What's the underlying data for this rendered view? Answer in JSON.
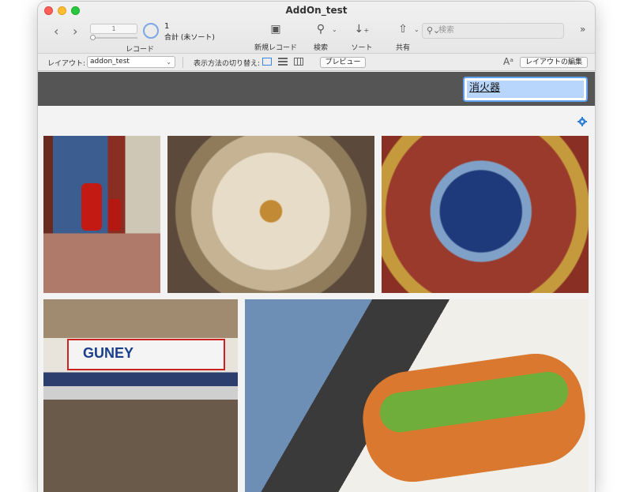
{
  "window": {
    "title": "AddOn_test"
  },
  "toolbar": {
    "record_number": "1",
    "records_label": "レコード",
    "found_count": "1",
    "found_sub": "合計 (未ソート)",
    "new_record_label": "新規レコード",
    "find_label": "検索",
    "sort_label": "ソート",
    "share_label": "共有",
    "search_placeholder": "検索"
  },
  "layoutbar": {
    "layout_label": "レイアウト:",
    "layout_value": "addon_test",
    "view_switch_label": "表示方法の切り替え:",
    "preview_label": "プレビュー",
    "edit_layout_label": "レイアウトの編集"
  },
  "content": {
    "tag_field_value": "消火器",
    "photos": [
      {
        "name": "photo-tiled-room-fire-extinguisher"
      },
      {
        "name": "photo-ornate-dome-ceiling"
      },
      {
        "name": "photo-ornate-ceiling-medallion"
      },
      {
        "name": "photo-guney-shop-storefront",
        "sign_text": "GUNEY"
      },
      {
        "name": "photo-fish-sandwich"
      }
    ]
  }
}
